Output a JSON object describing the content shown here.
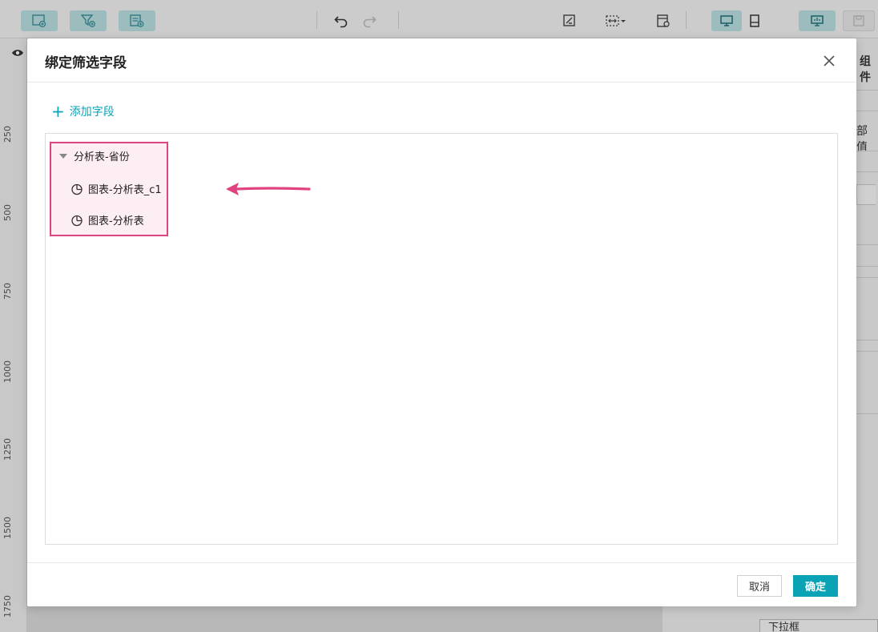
{
  "dialog": {
    "title": "绑定筛选字段",
    "add_field_label": "添加字段",
    "tree": {
      "group_label": "分析表-省份",
      "items": [
        {
          "label": "图表-分析表_c1",
          "icon": "pie-chart-icon"
        },
        {
          "label": "图表-分析表",
          "icon": "pie-chart-icon"
        }
      ]
    },
    "footer": {
      "cancel_label": "取消",
      "ok_label": "确定"
    }
  },
  "background": {
    "ruler_labels": [
      "250",
      "500",
      "750",
      "1000",
      "1250",
      "1500",
      "1750"
    ],
    "right_panel": {
      "partial_text_1": "组件",
      "partial_text_2": "部值",
      "dropdown_text": "下拉框"
    }
  },
  "colors": {
    "accent": "#0aa3b6",
    "highlight_border": "#e0437f",
    "highlight_fill": "#fdeef4",
    "arrow": "#e0437f"
  }
}
